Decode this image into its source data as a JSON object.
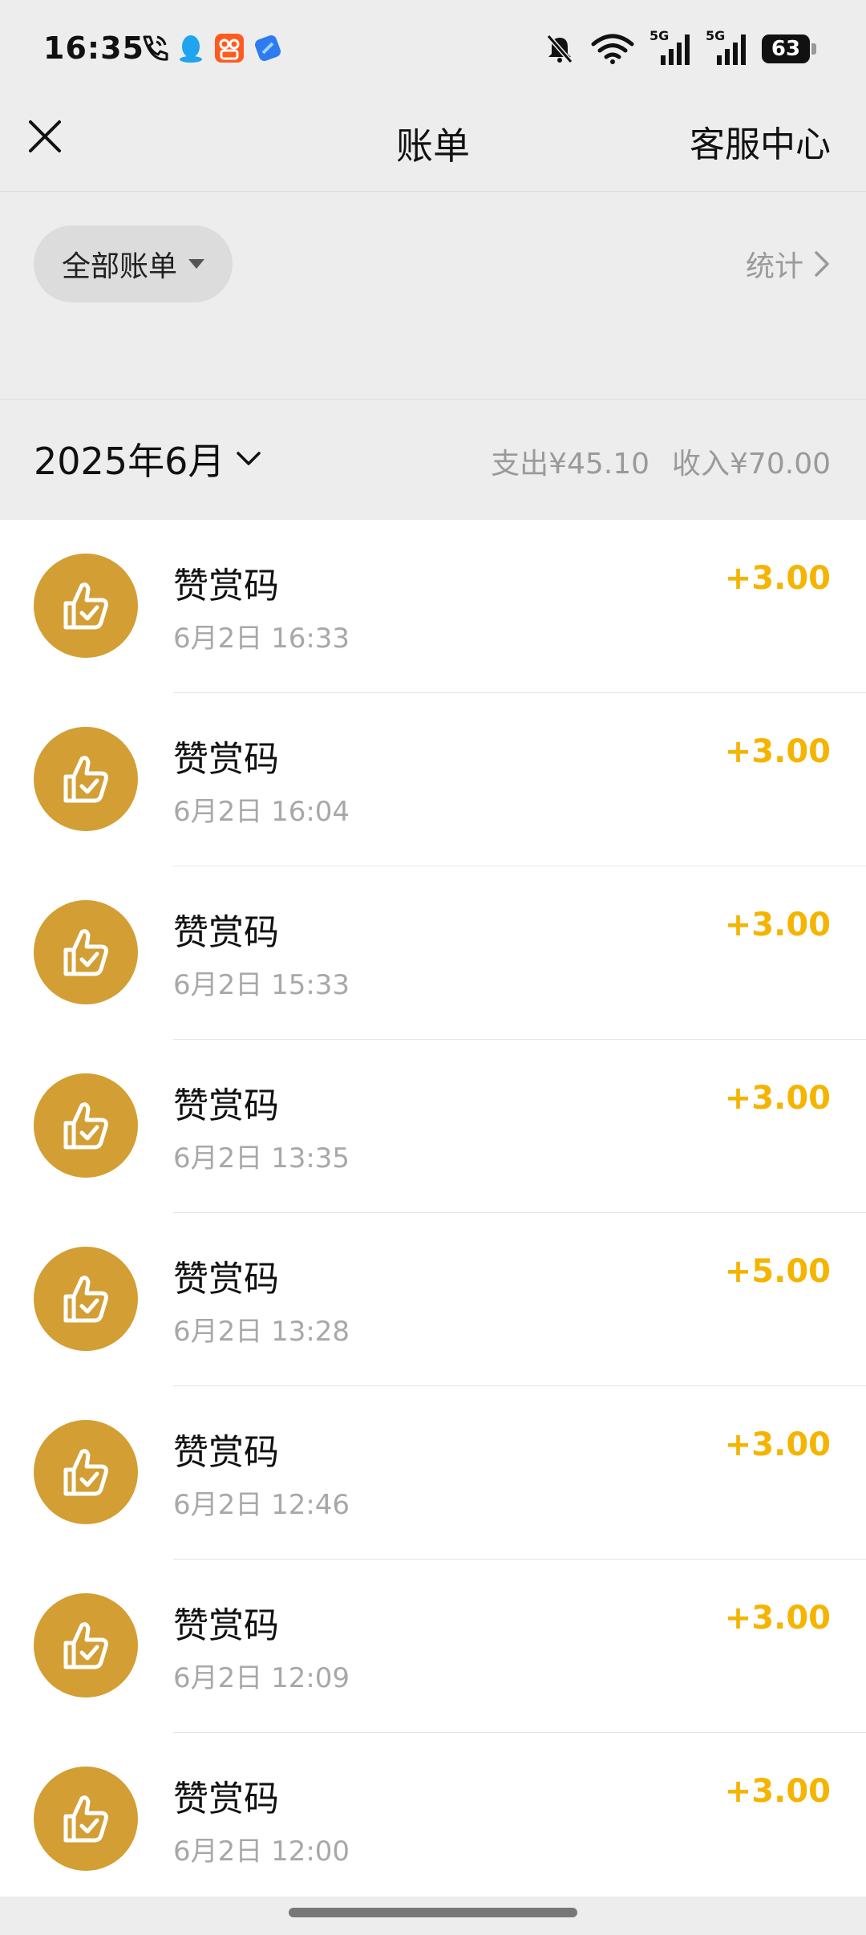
{
  "status_bar": {
    "time": "16:35",
    "icons_left": [
      "phone-call-icon",
      "qq-icon",
      "app-icon",
      "browser-icon"
    ],
    "icons_right": [
      "mute-bell-icon",
      "wifi-icon",
      "signal-5g-icon",
      "signal-5g-icon"
    ],
    "signal_label_1": "5G",
    "signal_label_2": "5G",
    "battery_level": "63"
  },
  "nav": {
    "title": "账单",
    "service_label": "客服中心"
  },
  "filter": {
    "pill_label": "全部账单",
    "stats_label": "统计"
  },
  "month": {
    "label": "2025年6月",
    "expense": "支出¥45.10",
    "income": "收入¥70.00"
  },
  "colors": {
    "accent_gold": "#d39e33",
    "amount_yellow": "#f4b400"
  },
  "transactions": [
    {
      "title": "赞赏码",
      "time": "6月2日 16:33",
      "amount": "+3.00",
      "icon": "thumbs-up-check-icon"
    },
    {
      "title": "赞赏码",
      "time": "6月2日 16:04",
      "amount": "+3.00",
      "icon": "thumbs-up-check-icon"
    },
    {
      "title": "赞赏码",
      "time": "6月2日 15:33",
      "amount": "+3.00",
      "icon": "thumbs-up-check-icon"
    },
    {
      "title": "赞赏码",
      "time": "6月2日 13:35",
      "amount": "+3.00",
      "icon": "thumbs-up-check-icon"
    },
    {
      "title": "赞赏码",
      "time": "6月2日 13:28",
      "amount": "+5.00",
      "icon": "thumbs-up-check-icon"
    },
    {
      "title": "赞赏码",
      "time": "6月2日 12:46",
      "amount": "+3.00",
      "icon": "thumbs-up-check-icon"
    },
    {
      "title": "赞赏码",
      "time": "6月2日 12:09",
      "amount": "+3.00",
      "icon": "thumbs-up-check-icon"
    },
    {
      "title": "赞赏码",
      "time": "6月2日 12:00",
      "amount": "+3.00",
      "icon": "thumbs-up-check-icon"
    }
  ]
}
